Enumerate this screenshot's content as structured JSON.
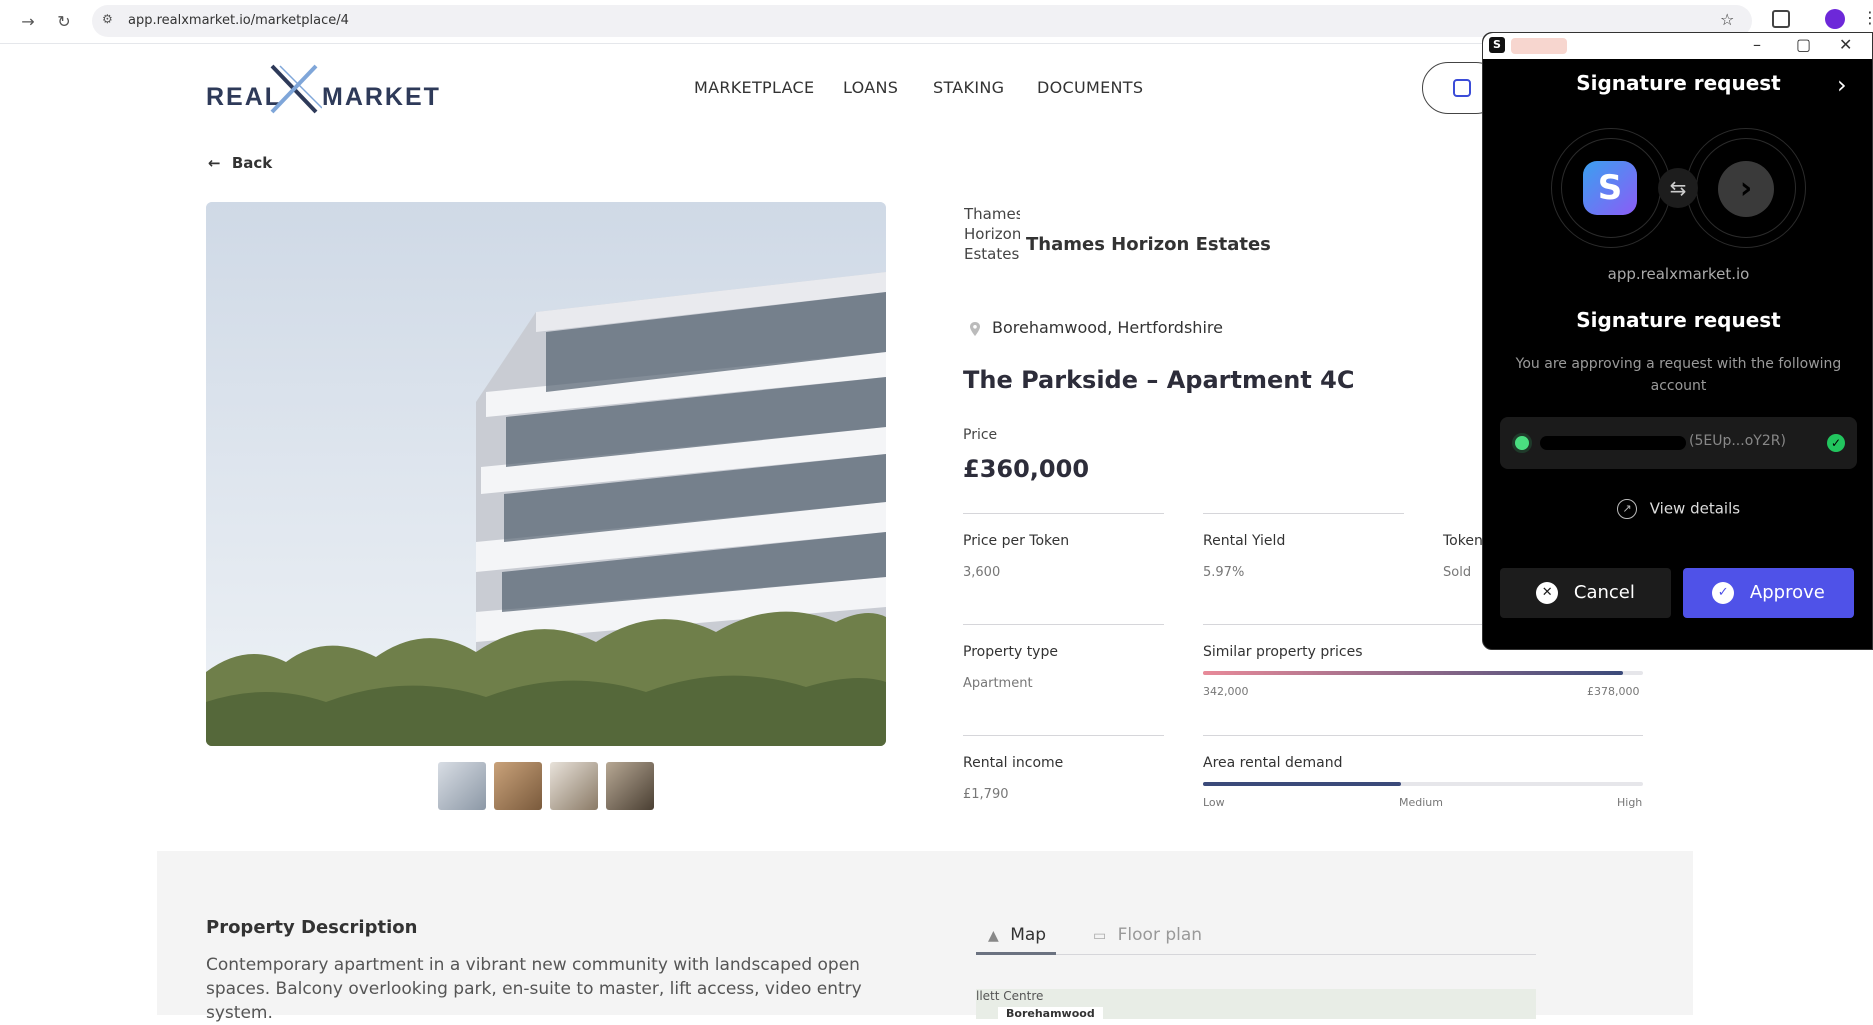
{
  "browser": {
    "url": "app.realxmarket.io/marketplace/4"
  },
  "site": {
    "logo_left": "REAL",
    "logo_right": "MARKET",
    "nav": [
      "MARKETPLACE",
      "LOANS",
      "STAKING",
      "DOCUMENTS"
    ],
    "back_label": "Back"
  },
  "property": {
    "brand_alt": "Thames Horizon Estates",
    "brand_name": "Thames Horizon Estates",
    "location": "Borehamwood, Hertfordshire",
    "title": "The Parkside – Apartment 4C",
    "price_label": "Price",
    "price": "£360,000",
    "price_per_token_label": "Price per Token",
    "price_per_token": "3,600",
    "rental_yield_label": "Rental Yield",
    "rental_yield": "5.97%",
    "tokens_label": "Token",
    "tokens_value": "Sold",
    "property_type_label": "Property type",
    "property_type": "Apartment",
    "similar_label": "Similar property prices",
    "similar_min": "342,000",
    "similar_max": "£378,000",
    "rental_income_label": "Rental income",
    "rental_income": "£1,790",
    "demand_label": "Area rental demand",
    "demand_low": "Low",
    "demand_medium": "Medium",
    "demand_high": "High",
    "demand_level": 0.45
  },
  "description": {
    "title": "Property Description",
    "text": "Contemporary apartment in a vibrant new community with landscaped open spaces. Balcony overlooking park, en-suite to master, lift access, video entry system.",
    "tab_map": "Map",
    "tab_floor": "Floor plan",
    "map_label_1": "llett Centre",
    "map_label_2": "Borehamwood"
  },
  "popup": {
    "header_title": "Signature request",
    "domain": "app.realxmarket.io",
    "title": "Signature request",
    "subtitle": "You are approving a request with the following account",
    "account_short": "(5EUp...oY2R)",
    "view_details": "View details",
    "cancel": "Cancel",
    "approve": "Approve"
  },
  "colors": {
    "approve": "#4f52e8",
    "similar_bar_start": "#e88a99",
    "similar_bar_end": "#3b4a7a",
    "demand_bar": "#3b4a7a"
  }
}
